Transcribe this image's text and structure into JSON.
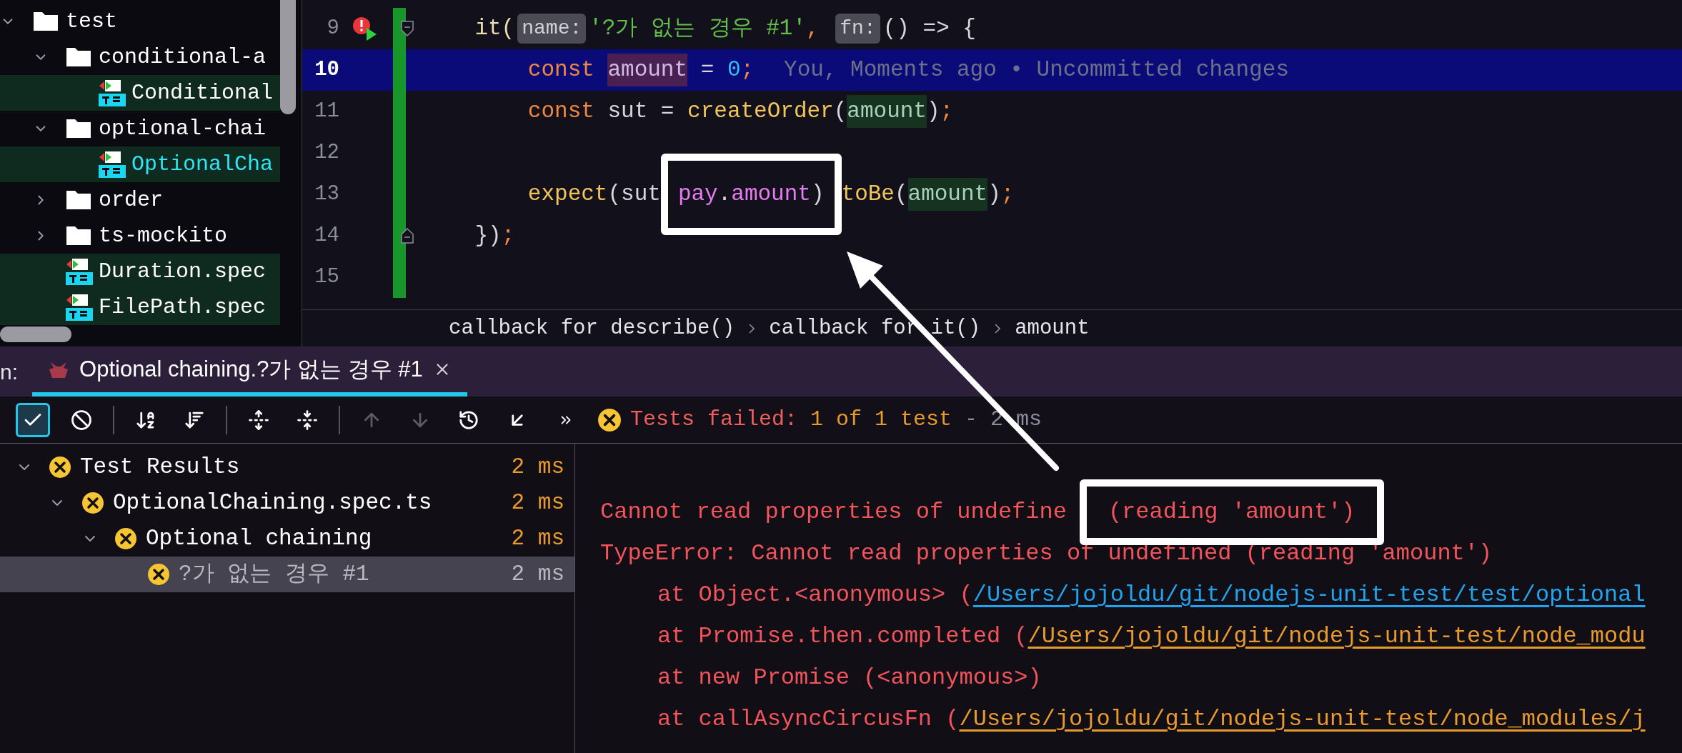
{
  "project_tree": [
    {
      "label": "test",
      "kind": "folder",
      "expanded": true,
      "selected": false,
      "children": [
        {
          "label": "conditional-a",
          "kind": "folder",
          "expanded": true,
          "selected": false,
          "children": [
            {
              "label": "Conditional",
              "kind": "spec",
              "selected": false
            }
          ]
        },
        {
          "label": "optional-chai",
          "kind": "folder",
          "expanded": true,
          "selected": false,
          "children": [
            {
              "label": "OptionalCha",
              "kind": "spec",
              "selected": true
            }
          ]
        },
        {
          "label": "order",
          "kind": "folder",
          "expanded": false,
          "selected": false
        },
        {
          "label": "ts-mockito",
          "kind": "folder",
          "expanded": false,
          "selected": false
        },
        {
          "label": "Duration.spec",
          "kind": "spec",
          "selected": false
        },
        {
          "label": "FilePath.spec",
          "kind": "spec",
          "selected": false
        }
      ]
    }
  ],
  "editor": {
    "lines": [
      {
        "number": "9",
        "current": false,
        "changed": true,
        "markers": [
          {
            "kind": "failed-run"
          },
          {
            "kind": "fold-start"
          }
        ],
        "tokens": [
          {
            "text": "    it(",
            "kind": "call"
          },
          {
            "text": "name:",
            "kind": "hint"
          },
          {
            "text": "'?가 없는 경우 #1'",
            "kind": "string"
          },
          {
            "text": ", ",
            "kind": "punct"
          },
          {
            "text": "fn:",
            "kind": "hint"
          },
          {
            "text": "() => {",
            "kind": "plain"
          }
        ]
      },
      {
        "number": "10",
        "current": true,
        "changed": true,
        "tokens": [
          {
            "text": "        const ",
            "kind": "keyword"
          },
          {
            "text": "amount",
            "kind": "decl"
          },
          {
            "text": " = ",
            "kind": "plain"
          },
          {
            "text": "0",
            "kind": "number"
          },
          {
            "text": ";",
            "kind": "punct"
          },
          {
            "text": "You, Moments ago • Uncommitted changes",
            "kind": "blame"
          }
        ]
      },
      {
        "number": "11",
        "current": false,
        "changed": true,
        "tokens": [
          {
            "text": "        const",
            "kind": "keyword"
          },
          {
            "text": " sut = ",
            "kind": "plain"
          },
          {
            "text": "createOrder",
            "kind": "func"
          },
          {
            "text": "(",
            "kind": "plain"
          },
          {
            "text": "amount",
            "kind": "ref"
          },
          {
            "text": ")",
            "kind": "plain"
          },
          {
            "text": ";",
            "kind": "punct"
          }
        ]
      },
      {
        "number": "12",
        "current": false,
        "changed": true
      },
      {
        "number": "13",
        "current": false,
        "changed": true,
        "tokens": [
          {
            "text": "        expect",
            "kind": "func"
          },
          {
            "text": "(sut",
            "kind": "plain"
          },
          {
            "kind": "callout",
            "tokens": [
              {
                "text": "pay",
                "kind": "prop"
              },
              {
                "text": ".",
                "kind": "plain"
              },
              {
                "text": "amount",
                "kind": "prop"
              },
              {
                "text": ")",
                "kind": "plain"
              }
            ]
          },
          {
            "text": "toBe",
            "kind": "func"
          },
          {
            "text": "(",
            "kind": "plain"
          },
          {
            "text": "amount",
            "kind": "ref"
          },
          {
            "text": ")",
            "kind": "plain"
          },
          {
            "text": ";",
            "kind": "punct"
          }
        ]
      },
      {
        "number": "14",
        "current": false,
        "changed": true,
        "markers": [
          {
            "kind": "fold-end"
          }
        ],
        "tokens": [
          {
            "text": "    })",
            "kind": "plain"
          },
          {
            "text": ";",
            "kind": "punct"
          }
        ]
      },
      {
        "number": "15",
        "current": false,
        "changed": true
      }
    ],
    "breadcrumb": [
      "callback for describe()",
      "callback for it()",
      "amount"
    ]
  },
  "run_panel": {
    "label_prefix": "n:",
    "tabs": [
      {
        "label": "Optional chaining.?가 없는 경우 #1",
        "selected": true
      }
    ]
  },
  "toolbar": [
    {
      "kind": "show-passed",
      "selected": true,
      "disabled": false
    },
    {
      "kind": "show-ignored",
      "selected": false,
      "disabled": false
    },
    {
      "kind": "sort-alpha",
      "selected": false,
      "disabled": false
    },
    {
      "kind": "sort-duration",
      "selected": false,
      "disabled": false
    },
    {
      "kind": "expand-all",
      "selected": false,
      "disabled": false
    },
    {
      "kind": "collapse-all",
      "selected": false,
      "disabled": false
    },
    {
      "kind": "previous",
      "selected": false,
      "disabled": true
    },
    {
      "kind": "next",
      "selected": false,
      "disabled": true
    },
    {
      "kind": "history",
      "selected": false,
      "disabled": false
    },
    {
      "kind": "import",
      "selected": false,
      "disabled": false
    },
    {
      "kind": "more",
      "selected": false,
      "disabled": false
    }
  ],
  "status": {
    "kind": "failed",
    "parts": [
      {
        "text": "Tests failed: ",
        "kind": "error"
      },
      {
        "text": "1 of 1 test",
        "kind": "count"
      },
      {
        "text": " - 2 ms",
        "kind": "muted"
      }
    ]
  },
  "test_results": [
    {
      "label": "Test Results",
      "kind": "failed",
      "time": "2 ms",
      "expanded": true,
      "selected": false,
      "children": [
        {
          "label": "OptionalChaining.spec.ts",
          "kind": "failed",
          "time": "2 ms",
          "expanded": true,
          "selected": false,
          "children": [
            {
              "label": "Optional chaining",
              "kind": "failed",
              "time": "2 ms",
              "expanded": true,
              "selected": false,
              "children": [
                {
                  "label": "?가 없는 경우 #1",
                  "kind": "failed",
                  "time": "2 ms",
                  "selected": true
                }
              ]
            }
          ]
        }
      ]
    }
  ],
  "console": [
    {
      "kind": "message",
      "text": "Cannot read properties of undefine",
      "callout": "(reading 'amount')"
    },
    {
      "kind": "message",
      "text": "TypeError: Cannot read properties of undefined (reading 'amount')"
    },
    {
      "kind": "frame",
      "text": "at Object.<anonymous> (",
      "link": {
        "text": "/Users/jojoldu/git/nodejs-unit-test/test/optional",
        "kind": "source"
      }
    },
    {
      "kind": "frame",
      "text": "at Promise.then.completed (",
      "link": {
        "text": "/Users/jojoldu/git/nodejs-unit-test/node_modu",
        "kind": "library"
      }
    },
    {
      "kind": "frame",
      "text": "at new Promise (<anonymous>)"
    },
    {
      "kind": "frame",
      "text": "at callAsyncCircusFn (",
      "link": {
        "text": "/Users/jojoldu/git/nodejs-unit-test/node_modules/j",
        "kind": "library"
      }
    }
  ]
}
